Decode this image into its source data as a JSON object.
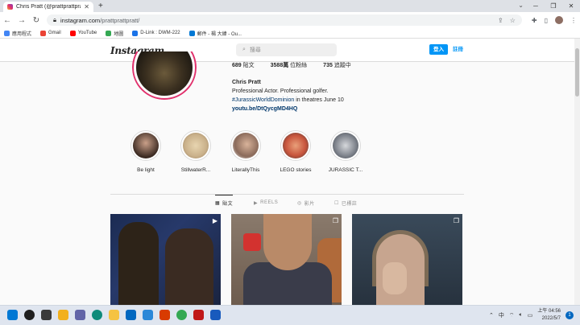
{
  "browser": {
    "tab_title": "Chris Pratt (@prattprattpratt)",
    "tab_close": "✕",
    "new_tab": "+",
    "tabs_dropdown": "⌄",
    "window_controls": [
      "─",
      "❐",
      "✕"
    ],
    "url_host": "instagram.com",
    "url_path": "/prattprattpratt/",
    "bookmarks": [
      {
        "label": "應用程式",
        "color": "#4285f4"
      },
      {
        "label": "Gmail",
        "color": "#ea4335"
      },
      {
        "label": "YouTube",
        "color": "#ff0000"
      },
      {
        "label": "地圖",
        "color": "#34a853"
      },
      {
        "label": "D-Link : DWM-222",
        "color": "#1a73e8"
      },
      {
        "label": "郵件 - 楊 大緯 - Ou...",
        "color": "#0078d4"
      }
    ]
  },
  "instagram": {
    "logo": "Instagram",
    "search_placeholder": "搜尋",
    "login_label": "登入",
    "signup_label": "註冊",
    "stats": {
      "posts_count": "689",
      "posts_label": "貼文",
      "followers_count": "3588萬",
      "followers_label": "位粉絲",
      "following_count": "735",
      "following_label": "追蹤中"
    },
    "bio": {
      "name": "Chris Pratt",
      "line1": "Professional Actor. Professional golfer.",
      "line2_tag": "#JurassicWorldDominion",
      "line2_rest": " in theatres June 10",
      "link": "youtu.be/DtQycgMD4HQ"
    },
    "highlights": [
      {
        "label": "Be light",
        "color": "#3b2a22"
      },
      {
        "label": "StillwaterR...",
        "color": "#c9b08a"
      },
      {
        "label": "LiterallyThis",
        "color": "#8a6a5a"
      },
      {
        "label": "LEGO stories",
        "color": "#c8553d"
      },
      {
        "label": "JURASSIC T...",
        "color": "#7a7f88"
      }
    ],
    "profile_tabs": [
      {
        "label": "貼文",
        "icon": "▦"
      },
      {
        "label": "REELS",
        "icon": "▶"
      },
      {
        "label": "影片",
        "icon": "◎"
      },
      {
        "label": "已標註",
        "icon": "☐"
      }
    ],
    "posts": [
      {
        "badge": "▶"
      },
      {
        "badge": "❐"
      },
      {
        "badge": "❐"
      }
    ]
  },
  "taskbar": {
    "apps": [
      {
        "name": "windows-start",
        "color": "#0078d4"
      },
      {
        "name": "search",
        "color": "#1f1f1f"
      },
      {
        "name": "task-view",
        "color": "#3a3a3a"
      },
      {
        "name": "widgets",
        "color": "#f2b01e"
      },
      {
        "name": "chat",
        "color": "#6264a7"
      },
      {
        "name": "edge",
        "color": "#0f8a7a"
      },
      {
        "name": "file-explorer",
        "color": "#f5c342"
      },
      {
        "name": "store",
        "color": "#0067c0"
      },
      {
        "name": "photos",
        "color": "#2b88d8"
      },
      {
        "name": "office",
        "color": "#d83b01"
      },
      {
        "name": "chrome",
        "color": "#34a853"
      },
      {
        "name": "mcafee",
        "color": "#c01818"
      },
      {
        "name": "word",
        "color": "#185abd"
      }
    ],
    "time": "上午 04:56",
    "date": "2022/5/7",
    "notification_count": "1"
  }
}
